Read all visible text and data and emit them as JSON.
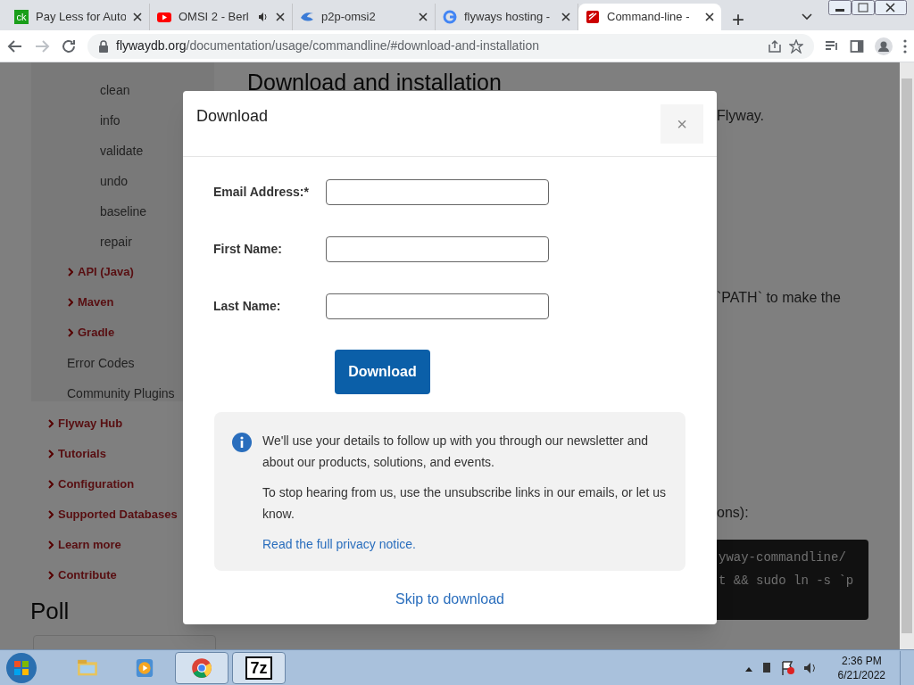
{
  "browser": {
    "tabs": [
      {
        "title": "Pay Less for Auto",
        "favicon": "ck",
        "audio": false,
        "selected": false
      },
      {
        "title": "OMSI 2 - Berl",
        "audio": true,
        "selected": false
      },
      {
        "title": "p2p-omsi2",
        "audio": false,
        "selected": false
      },
      {
        "title": "flyways hosting -",
        "audio": false,
        "selected": false
      },
      {
        "title": "Command-line -",
        "audio": false,
        "selected": true
      }
    ],
    "new_tab": "+",
    "address": {
      "domain": "flywaydb.org",
      "path": "/documentation/usage/commandline/#download-and-installation"
    }
  },
  "page": {
    "heading": "Download and installation",
    "fragments": [
      "Flyway.",
      "`PATH` to make the",
      "ons):"
    ],
    "code_lines": [
      "yway-commandline/",
      "t && sudo ln -s `p"
    ],
    "poll_heading": "Poll",
    "sidebar": {
      "items": [
        {
          "children": [
            {
              "children": [
                {
                  "label": "clean"
                },
                {
                  "label": "info"
                },
                {
                  "label": "validate"
                },
                {
                  "label": "undo"
                },
                {
                  "label": "baseline"
                },
                {
                  "label": "repair"
                }
              ]
            },
            {
              "label": "API (Java)",
              "expandable": true
            },
            {
              "label": "Maven",
              "expandable": true
            },
            {
              "label": "Gradle",
              "expandable": true
            },
            {
              "label": "Error Codes",
              "expandable": false
            },
            {
              "label": "Community Plugins",
              "expandable": false
            }
          ]
        },
        {
          "label": "Flyway Hub",
          "expandable": true
        },
        {
          "label": "Tutorials",
          "expandable": true
        },
        {
          "label": "Configuration",
          "expandable": true
        },
        {
          "label": "Supported Databases",
          "expandable": true
        },
        {
          "label": "Learn more",
          "expandable": true
        },
        {
          "label": "Contribute",
          "expandable": true
        }
      ]
    }
  },
  "modal": {
    "title": "Download",
    "close": "×",
    "fields": [
      {
        "label": "Email Address:*"
      },
      {
        "label": "First Name:"
      },
      {
        "label": "Last Name:"
      }
    ],
    "button": "Download",
    "notice": [
      "We'll use your details to follow up with you through our newsletter and about our products, solutions, and events.",
      "To stop hearing from us, use the unsubscribe links in our emails, or let us know."
    ],
    "notice_link": "Read the full privacy notice.",
    "skip_link": "Skip to download"
  },
  "taskbar": {
    "apps": [
      {
        "kind": "explorer",
        "selected": false
      },
      {
        "kind": "media",
        "selected": false
      },
      {
        "kind": "chrome",
        "selected": true
      },
      {
        "kind": "sevenzip",
        "label": "7z",
        "selected": true
      }
    ],
    "time": "2:36 PM",
    "date": "6/21/2022"
  }
}
